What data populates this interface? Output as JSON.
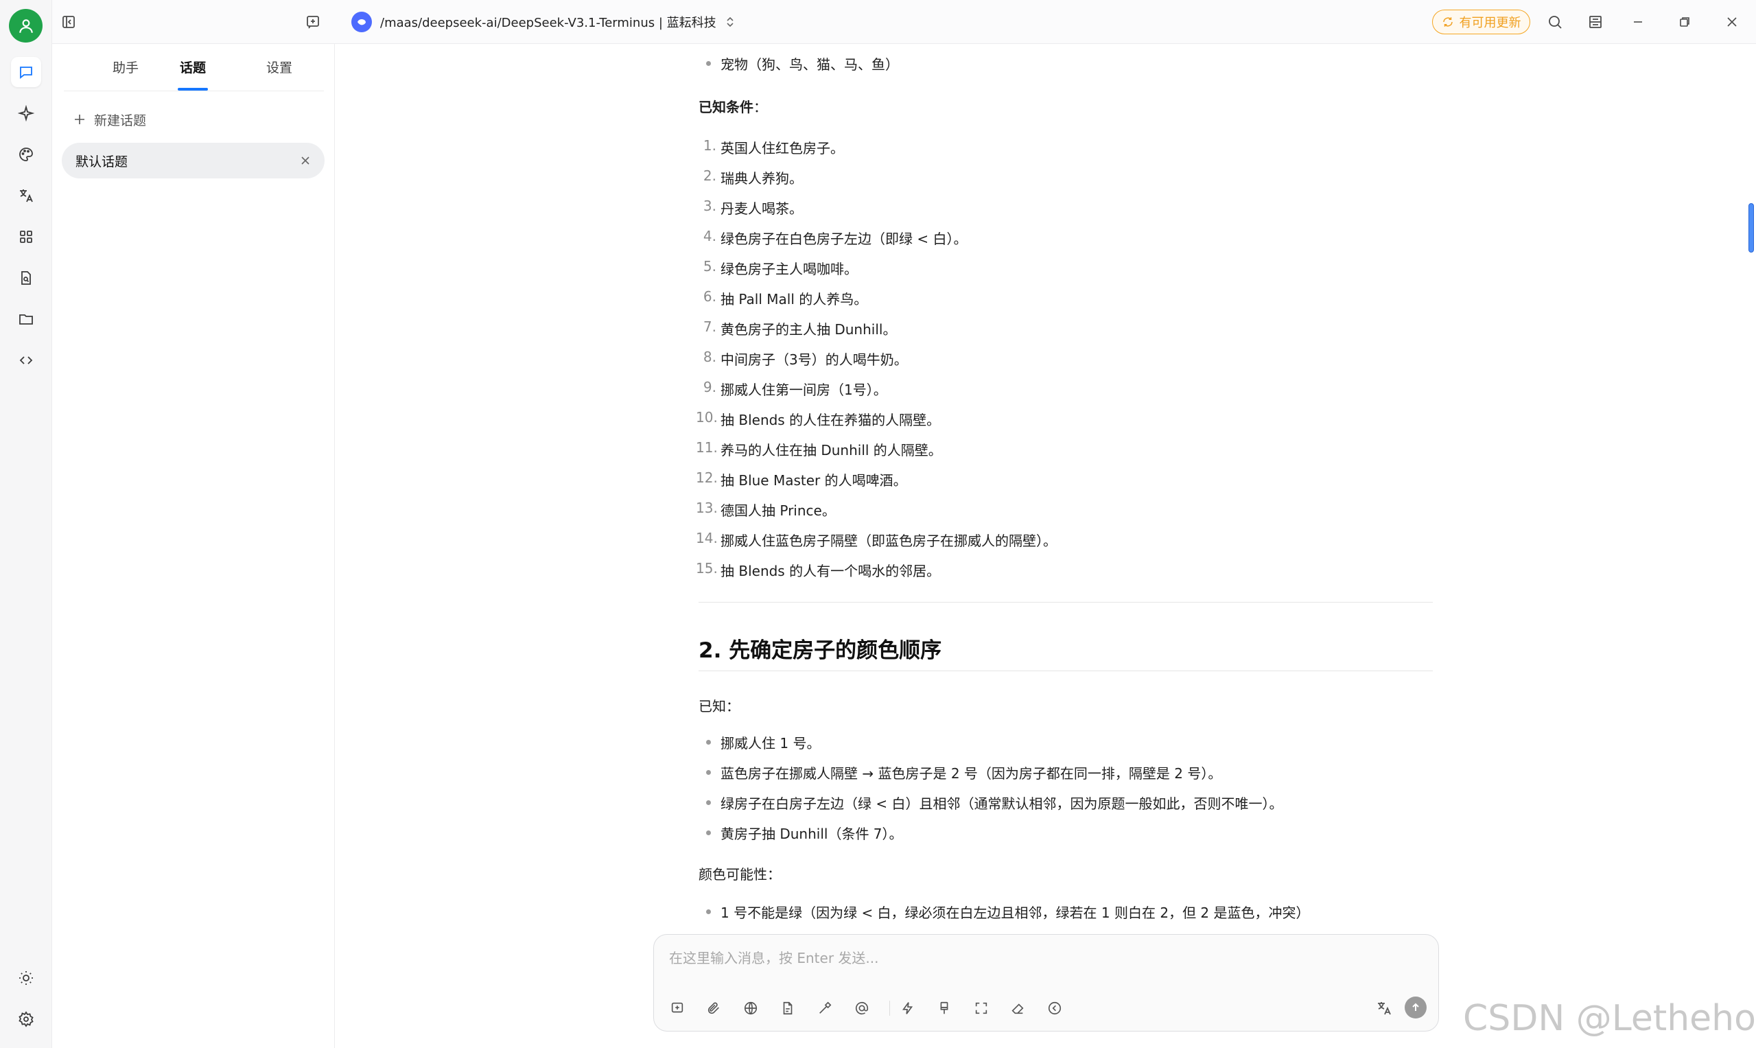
{
  "topbar": {
    "model_path": "/maas/deepseek-ai/DeepSeek-V3.1-Terminus | 蓝耘科技",
    "update_label": "有可用更新"
  },
  "sidebar": {
    "tabs": [
      {
        "label": "助手"
      },
      {
        "label": "话题"
      },
      {
        "label": "设置"
      }
    ],
    "new_topic_label": "新建话题",
    "topics": [
      {
        "label": "默认话题"
      }
    ]
  },
  "content": {
    "top_bullet": "宠物（狗、鸟、猫、马、鱼）",
    "known_heading": "已知条件",
    "known_colon": "：",
    "conditions": [
      {
        "num": "1.",
        "text": "英国人住红色房子。"
      },
      {
        "num": "2.",
        "text": "瑞典人养狗。"
      },
      {
        "num": "3.",
        "text": "丹麦人喝茶。"
      },
      {
        "num": "4.",
        "text": "绿色房子在白色房子左边（即绿 < 白）。"
      },
      {
        "num": "5.",
        "text": "绿色房子主人喝咖啡。"
      },
      {
        "num": "6.",
        "text": "抽 Pall Mall 的人养鸟。"
      },
      {
        "num": "7.",
        "text": "黄色房子的主人抽 Dunhill。"
      },
      {
        "num": "8.",
        "text": "中间房子（3号）的人喝牛奶。"
      },
      {
        "num": "9.",
        "text": "挪威人住第一间房（1号）。"
      },
      {
        "num": "10.",
        "text": "抽 Blends 的人住在养猫的人隔壁。"
      },
      {
        "num": "11.",
        "text": "养马的人住在抽 Dunhill 的人隔壁。"
      },
      {
        "num": "12.",
        "text": "抽 Blue Master 的人喝啤酒。"
      },
      {
        "num": "13.",
        "text": "德国人抽 Prince。"
      },
      {
        "num": "14.",
        "text": "挪威人住蓝色房子隔壁（即蓝色房子在挪威人的隔壁）。"
      },
      {
        "num": "15.",
        "text": "抽 Blends 的人有一个喝水的邻居。"
      }
    ],
    "section2_heading": "2. 先确定房子的颜色顺序",
    "known2_label": "已知：",
    "known2_bullets": [
      "挪威人住 1 号。",
      "蓝色房子在挪威人隔壁 → 蓝色房子是 2 号（因为房子都在同一排，隔壁是 2 号）。",
      "绿房子在白房子左边（绿 < 白）且相邻（通常默认相邻，因为原题一般如此，否则不唯一）。",
      "黄房子抽 Dunhill（条件 7）。"
    ],
    "color_possibility_label": "颜色可能性：",
    "color_bullets": [
      "1 号不能是绿（因为绿 < 白，绿必须在白左边且相邻，绿若在 1 则白在 2，但 2 是蓝色，冲突）"
    ]
  },
  "input": {
    "placeholder": "在这里输入消息，按 Enter 发送..."
  },
  "icons": {
    "rail": [
      "chat-icon",
      "sparkle-icon",
      "palette-icon",
      "translate-icon",
      "apps-icon",
      "file-search-icon",
      "folder-icon",
      "code-icon",
      "sun-icon",
      "settings-icon"
    ],
    "input_toolbar": [
      "new-topic-icon",
      "attachment-icon",
      "globe-icon",
      "document-icon",
      "hammer-icon",
      "at-icon",
      "lightning-icon",
      "brush-icon",
      "fullscreen-icon",
      "eraser-icon",
      "chevron-left-circle-icon",
      "translate-icon",
      "send-icon"
    ]
  },
  "watermark": "CSDN @Lethehong",
  "colors": {
    "accent": "#1677ff",
    "avatar": "#1fa34a",
    "update": "#f0a020",
    "model_logo": "#4d6bfe"
  }
}
